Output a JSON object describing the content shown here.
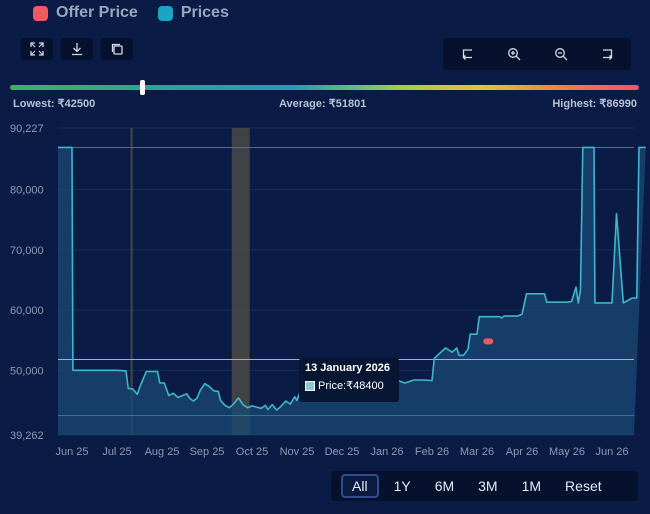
{
  "legend": [
    {
      "label": "Offer Price",
      "color": "#f05a5f"
    },
    {
      "label": "Prices",
      "color": "#1fa3c5"
    }
  ],
  "toolbar": {
    "left_icons": [
      "fullscreen-icon",
      "download-icon",
      "copy-icon"
    ],
    "zoom_icons": [
      "pan-left-icon",
      "zoom-in-icon",
      "zoom-out-icon",
      "pan-right-icon"
    ]
  },
  "stats": {
    "lowest": "Lowest: ₹42500",
    "average": "Average: ₹51801",
    "highest": "Highest: ₹86990"
  },
  "slider": {
    "position_fraction": 0.21
  },
  "tooltip": {
    "title": "13 January 2026",
    "label": "Price:₹48400"
  },
  "range_buttons": [
    {
      "label": "All",
      "active": true
    },
    {
      "label": "1Y",
      "active": false
    },
    {
      "label": "6M",
      "active": false
    },
    {
      "label": "3M",
      "active": false
    },
    {
      "label": "1M",
      "active": false
    },
    {
      "label": "Reset",
      "active": false
    }
  ],
  "colors": {
    "background": "#0a1b45",
    "line": "#3fb7c9",
    "area": "#1a4a73",
    "highest_line": "#c2415a",
    "average_line": "#c9b93a",
    "lowest_line": "#1e7f95",
    "offer_marker": "#f05a5f",
    "band": "#4a4a46",
    "grid": "#1b2c58"
  },
  "chart_data": {
    "type": "area",
    "ylim": [
      39262,
      90227
    ],
    "ytick_values": [
      39262,
      50000,
      60000,
      70000,
      80000,
      90227
    ],
    "ytick_labels": [
      "39,262",
      "50,000",
      "60,000",
      "70,000",
      "80,000",
      "90,227"
    ],
    "xtick_labels": [
      "Jun 25",
      "Jul 25",
      "Aug 25",
      "Sep 25",
      "Oct 25",
      "Nov 25",
      "Dec 25",
      "Jan 26",
      "Feb 26",
      "Mar 26",
      "Apr 26",
      "May 26",
      "Jun 26"
    ],
    "reference_lines": {
      "highest": 86990,
      "average": 51801,
      "lowest": 42500
    },
    "highlight_bands": [
      [
        1.3,
        1.35
      ],
      [
        3.55,
        3.95
      ]
    ],
    "series": [
      {
        "name": "Prices",
        "points": [
          [
            0.0,
            87000
          ],
          [
            0.02,
            50000
          ],
          [
            0.15,
            50000
          ],
          [
            1.0,
            50000
          ],
          [
            1.2,
            49900
          ],
          [
            1.25,
            47000
          ],
          [
            1.35,
            46900
          ],
          [
            1.45,
            46000
          ],
          [
            1.5,
            47100
          ],
          [
            1.65,
            49800
          ],
          [
            1.9,
            49800
          ],
          [
            1.95,
            47900
          ],
          [
            2.05,
            47900
          ],
          [
            2.15,
            45800
          ],
          [
            2.25,
            46200
          ],
          [
            2.35,
            45500
          ],
          [
            2.45,
            45800
          ],
          [
            2.55,
            46100
          ],
          [
            2.62,
            45300
          ],
          [
            2.7,
            44900
          ],
          [
            2.78,
            45400
          ],
          [
            2.85,
            46700
          ],
          [
            2.95,
            47800
          ],
          [
            3.05,
            47300
          ],
          [
            3.15,
            46600
          ],
          [
            3.25,
            46500
          ],
          [
            3.3,
            45000
          ],
          [
            3.4,
            44200
          ],
          [
            3.5,
            43800
          ],
          [
            3.6,
            44500
          ],
          [
            3.7,
            45400
          ],
          [
            3.8,
            44300
          ],
          [
            3.9,
            43800
          ],
          [
            4.0,
            44100
          ],
          [
            4.1,
            43900
          ],
          [
            4.2,
            43700
          ],
          [
            4.3,
            44200
          ],
          [
            4.35,
            43500
          ],
          [
            4.45,
            44300
          ],
          [
            4.55,
            43400
          ],
          [
            4.65,
            44100
          ],
          [
            4.75,
            44900
          ],
          [
            4.85,
            44400
          ],
          [
            4.95,
            45600
          ],
          [
            5.0,
            45000
          ],
          [
            5.05,
            46100
          ],
          [
            5.12,
            44900
          ],
          [
            5.2,
            46200
          ],
          [
            5.3,
            46800
          ],
          [
            5.5,
            46800
          ],
          [
            5.9,
            46800
          ],
          [
            6.0,
            46200
          ],
          [
            6.5,
            46200
          ],
          [
            7.0,
            47600
          ],
          [
            7.2,
            48400
          ],
          [
            7.4,
            47900
          ],
          [
            7.6,
            48400
          ],
          [
            7.8,
            48400
          ],
          [
            8.0,
            48300
          ],
          [
            8.05,
            52000
          ],
          [
            8.3,
            53700
          ],
          [
            8.45,
            53000
          ],
          [
            8.55,
            53700
          ],
          [
            8.6,
            52500
          ],
          [
            8.7,
            52500
          ],
          [
            8.8,
            53500
          ],
          [
            8.85,
            56000
          ],
          [
            9.0,
            56000
          ],
          [
            9.05,
            58900
          ],
          [
            9.5,
            58900
          ],
          [
            9.55,
            58700
          ],
          [
            9.6,
            59000
          ],
          [
            9.9,
            59000
          ],
          [
            10.0,
            59300
          ],
          [
            10.1,
            62700
          ],
          [
            10.5,
            62700
          ],
          [
            10.55,
            61300
          ],
          [
            11.0,
            61300
          ],
          [
            11.1,
            61400
          ],
          [
            11.2,
            63800
          ],
          [
            11.25,
            61200
          ],
          [
            11.3,
            63400
          ],
          [
            11.35,
            87000
          ],
          [
            11.6,
            87000
          ],
          [
            11.62,
            61200
          ],
          [
            12.0,
            61200
          ],
          [
            12.1,
            76000
          ],
          [
            12.25,
            61200
          ],
          [
            12.45,
            62000
          ],
          [
            12.55,
            62000
          ],
          [
            12.6,
            87000
          ],
          [
            12.75,
            87000
          ]
        ]
      }
    ],
    "offer_price_point": [
      9.25,
      54800
    ]
  }
}
